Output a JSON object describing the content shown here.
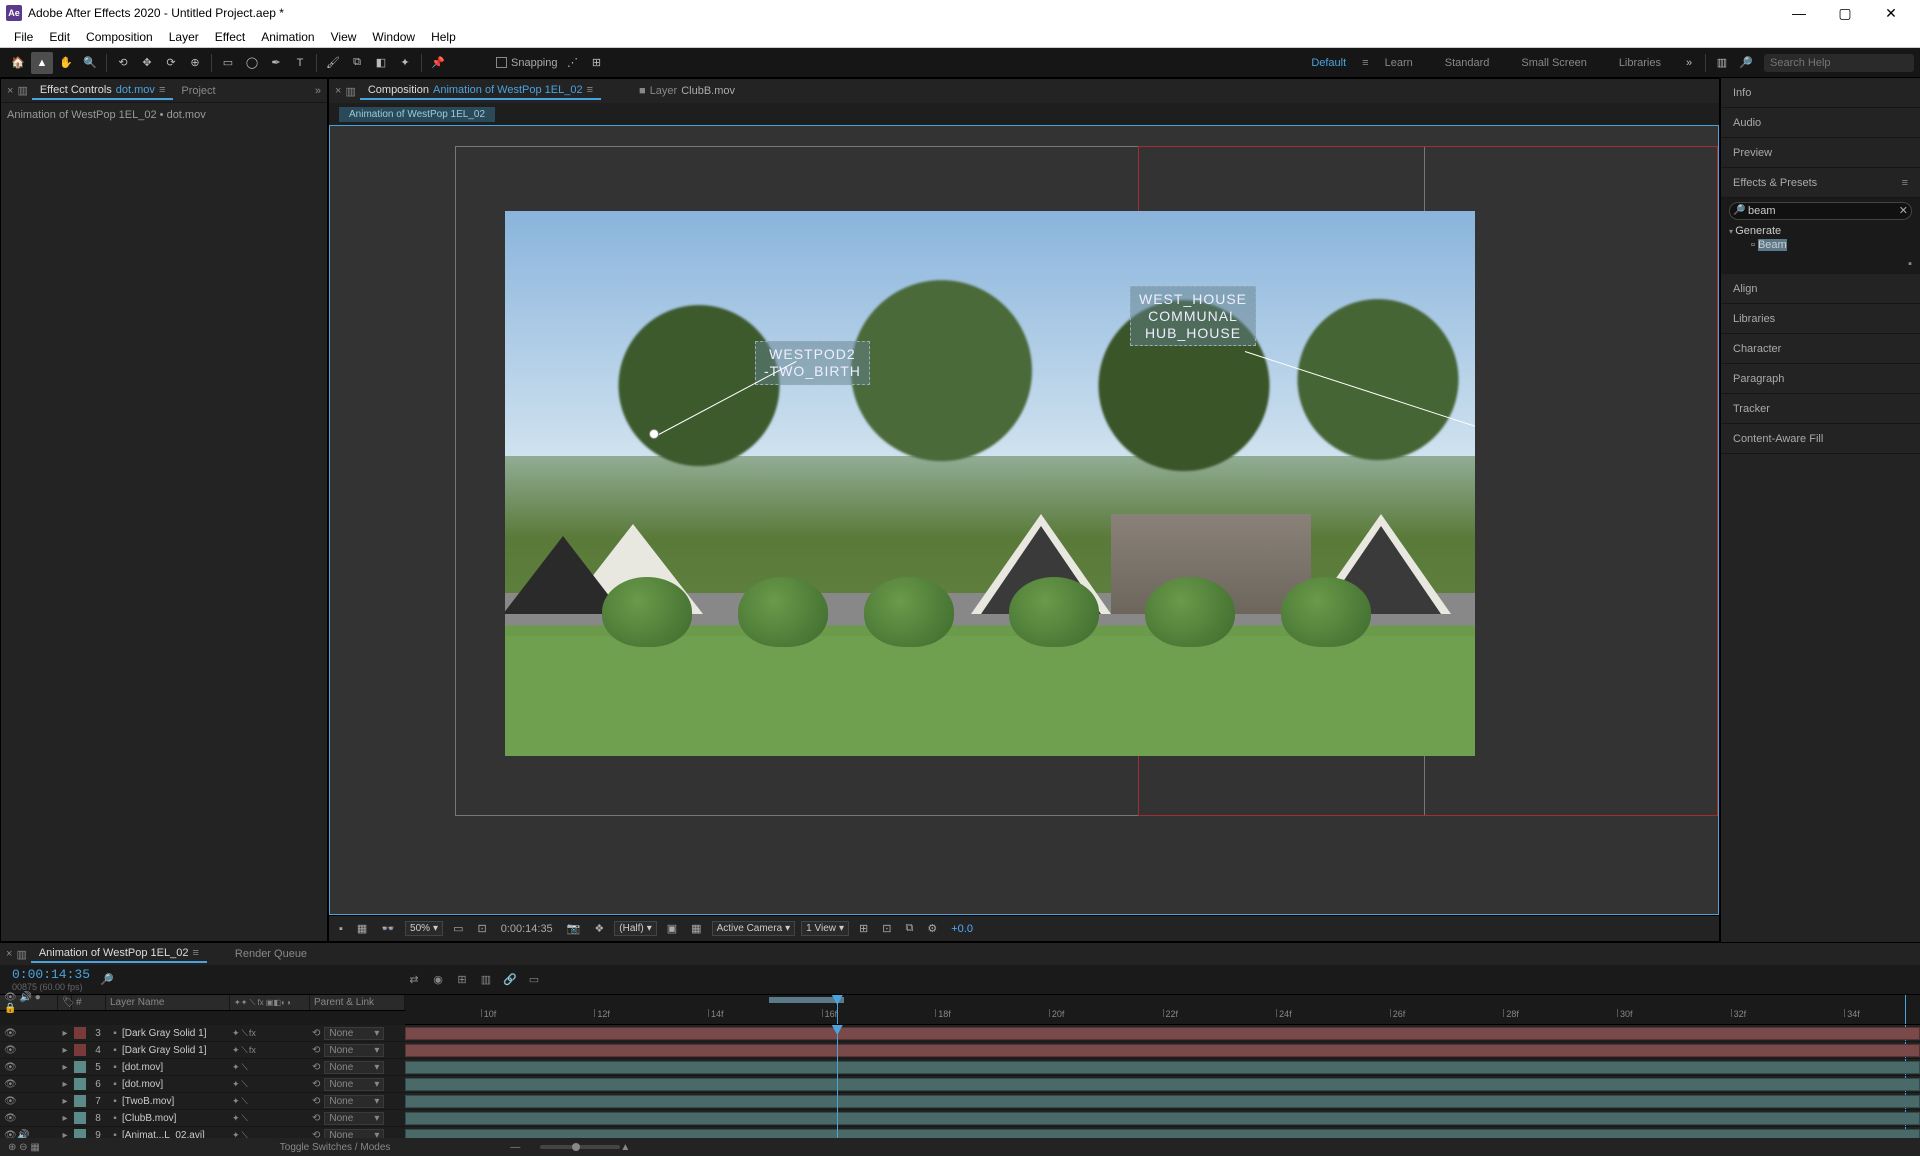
{
  "app": {
    "title": "Adobe After Effects 2020 - Untitled Project.aep *"
  },
  "menu": {
    "items": [
      "File",
      "Edit",
      "Composition",
      "Layer",
      "Effect",
      "Animation",
      "View",
      "Window",
      "Help"
    ]
  },
  "toolbar": {
    "snapping": "Snapping",
    "workspaces": [
      "Default",
      "Learn",
      "Standard",
      "Small Screen",
      "Libraries"
    ],
    "active_ws": "Default",
    "search_ph": "Search Help"
  },
  "left_panel": {
    "tabs": {
      "effect_controls": "Effect Controls",
      "ec_link": "dot.mov",
      "project": "Project"
    },
    "path": "Animation of WestPop 1EL_02 • dot.mov"
  },
  "comp": {
    "tab_prefix": "Composition",
    "tab_link": "Animation of WestPop 1EL_02",
    "layer_tab": "Layer",
    "layer_link": "ClubB.mov",
    "crumb": "Animation of WestPop 1EL_02",
    "labels": {
      "west_pod": "WESTPOD2\n-TWO_BIRTH",
      "west_house": "WEST_HOUSE\nCOMMUNAL\nHUB_HOUSE"
    },
    "footer": {
      "zoom": "50%",
      "tc": "0:00:14:35",
      "res": "(Half)",
      "camera": "Active Camera",
      "views": "1 View",
      "exp": "+0.0"
    }
  },
  "right": {
    "panels": [
      "Info",
      "Audio",
      "Preview"
    ],
    "effects_presets": "Effects & Presets",
    "ep_search": "beam",
    "ep_cat": "Generate",
    "ep_item": "Beam",
    "panels2": [
      "Align",
      "Libraries",
      "Character",
      "Paragraph",
      "Tracker",
      "Content-Aware Fill"
    ]
  },
  "timeline": {
    "tab": "Animation of WestPop 1EL_02",
    "rq": "Render Queue",
    "tc": "0:00:14:35",
    "frames": "00875 (60.00 fps)",
    "cols": {
      "layer_name": "Layer Name",
      "parent": "Parent & Link"
    },
    "ticks": [
      "10f",
      "12f",
      "14f",
      "16f",
      "18f",
      "20f",
      "22f",
      "24f",
      "26f",
      "28f",
      "30f",
      "32f",
      "34f"
    ],
    "layers": [
      {
        "n": 3,
        "name": "[Dark Gray Solid 1]",
        "color": "#7a3a3a",
        "parent": "None",
        "eye": true,
        "fx": true,
        "bar": "#7a4a4a"
      },
      {
        "n": 4,
        "name": "[Dark Gray Solid 1]",
        "color": "#7a3a3a",
        "parent": "None",
        "eye": true,
        "fx": true,
        "bar": "#7a4a4a"
      },
      {
        "n": 5,
        "name": "[dot.mov]",
        "color": "#5a8a8a",
        "parent": "None",
        "eye": true,
        "fx": false,
        "bar": "#4a6a6a"
      },
      {
        "n": 6,
        "name": "[dot.mov]",
        "color": "#5a8a8a",
        "parent": "None",
        "eye": true,
        "fx": false,
        "bar": "#4a6a6a"
      },
      {
        "n": 7,
        "name": "[TwoB.mov]",
        "color": "#5a8a8a",
        "parent": "None",
        "eye": true,
        "fx": false,
        "bar": "#4a6a6a"
      },
      {
        "n": 8,
        "name": "[ClubB.mov]",
        "color": "#5a8a8a",
        "parent": "None",
        "eye": true,
        "fx": false,
        "bar": "#4a6a6a"
      },
      {
        "n": 9,
        "name": "[Animat...L_02.avi]",
        "color": "#5a8a8a",
        "parent": "None",
        "eye": true,
        "fx": false,
        "bar": "#4a6a6a",
        "audio": true
      }
    ],
    "toggle": "Toggle Switches / Modes"
  }
}
